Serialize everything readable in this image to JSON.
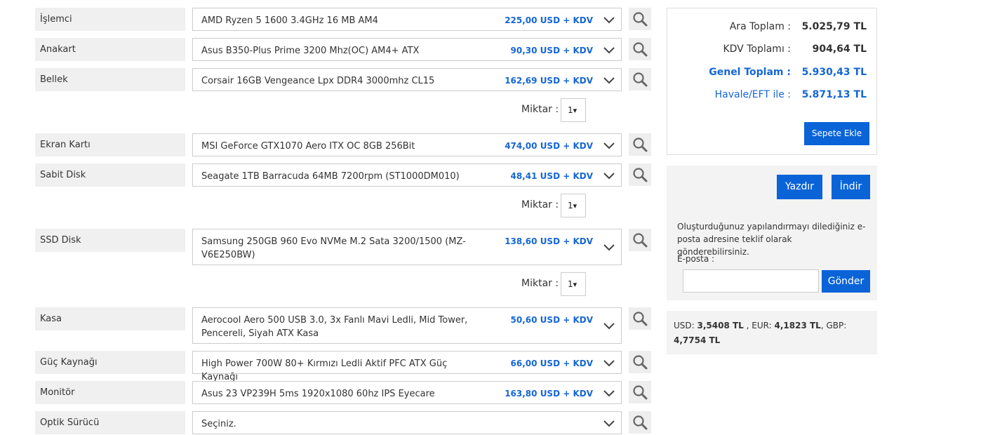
{
  "components": [
    {
      "label": "İşlemci",
      "product": "AMD Ryzen 5 1600 3.4GHz 16 MB AM4",
      "price": "225,00 USD + KDV"
    },
    {
      "label": "Anakart",
      "product": "Asus B350-Plus Prime 3200 Mhz(OC) AM4+ ATX",
      "price": "90,30 USD + KDV"
    },
    {
      "label": "Bellek",
      "product": "Corsair 16GB Vengeance Lpx DDR4 3000mhz CL15",
      "price": "162,69 USD + KDV"
    },
    {
      "label": "Ekran Kartı",
      "product": "MSI GeForce GTX1070 Aero ITX OC 8GB 256Bit",
      "price": "474,00 USD + KDV"
    },
    {
      "label": "Sabit Disk",
      "product": "Seagate 1TB Barracuda 64MB 7200rpm (ST1000DM010)",
      "price": "48,41 USD + KDV"
    },
    {
      "label": "SSD Disk",
      "product": "Samsung 250GB 960 Evo NVMe M.2 Sata 3200/1500 (MZ-V6E250BW)",
      "price": "138,60 USD + KDV"
    },
    {
      "label": "Kasa",
      "product": "Aerocool Aero 500 USB 3.0, 3x Fanlı Mavi Ledli, Mid Tower, Pencereli, Siyah ATX Kasa",
      "price": "50,60 USD + KDV"
    },
    {
      "label": "Güç Kaynağı",
      "product": "High Power 700W 80+ Kırmızı Ledli Aktif PFC ATX Güç Kaynağı",
      "price": "66,00 USD + KDV"
    },
    {
      "label": "Monitör",
      "product": "Asus 23 VP239H 5ms 1920x1080 60hz IPS Eyecare",
      "price": "163,80 USD + KDV"
    },
    {
      "label": "Optik Sürücü",
      "product": "Seçiniz.",
      "price": ""
    }
  ],
  "quantity": {
    "label": "Miktar :",
    "value": "1",
    "arrow": "▾"
  },
  "summary": {
    "ara_toplam_label": "Ara Toplam :",
    "ara_toplam_value": "5.025,79 TL",
    "kdv_label": "KDV Toplamı :",
    "kdv_value": "904,64 TL",
    "genel_label": "Genel Toplam :",
    "genel_value": "5.930,43 TL",
    "havale_label": "Havale/EFT ile :",
    "havale_value": "5.871,13 TL",
    "add_to_cart": "Sepete Ekle"
  },
  "share": {
    "print": "Yazdır",
    "download": "İndir",
    "description": "Oluşturduğunuz yapılandırmayı dilediğiniz e-posta adresine teklif olarak gönderebilirsiniz.",
    "email_label": "E-posta :",
    "email_value": "",
    "send": "Gönder"
  },
  "rates": {
    "usd_label": "USD:",
    "usd_value": "3,5408 TL",
    "eur_label": ", EUR:",
    "eur_value": "4,1823 TL",
    "gbp_label": ", GBP:",
    "gbp_value": "4,7754 TL"
  },
  "colors": {
    "accent": "#0a64d8",
    "price": "#1566d6",
    "panel": "#f3f3f3"
  }
}
